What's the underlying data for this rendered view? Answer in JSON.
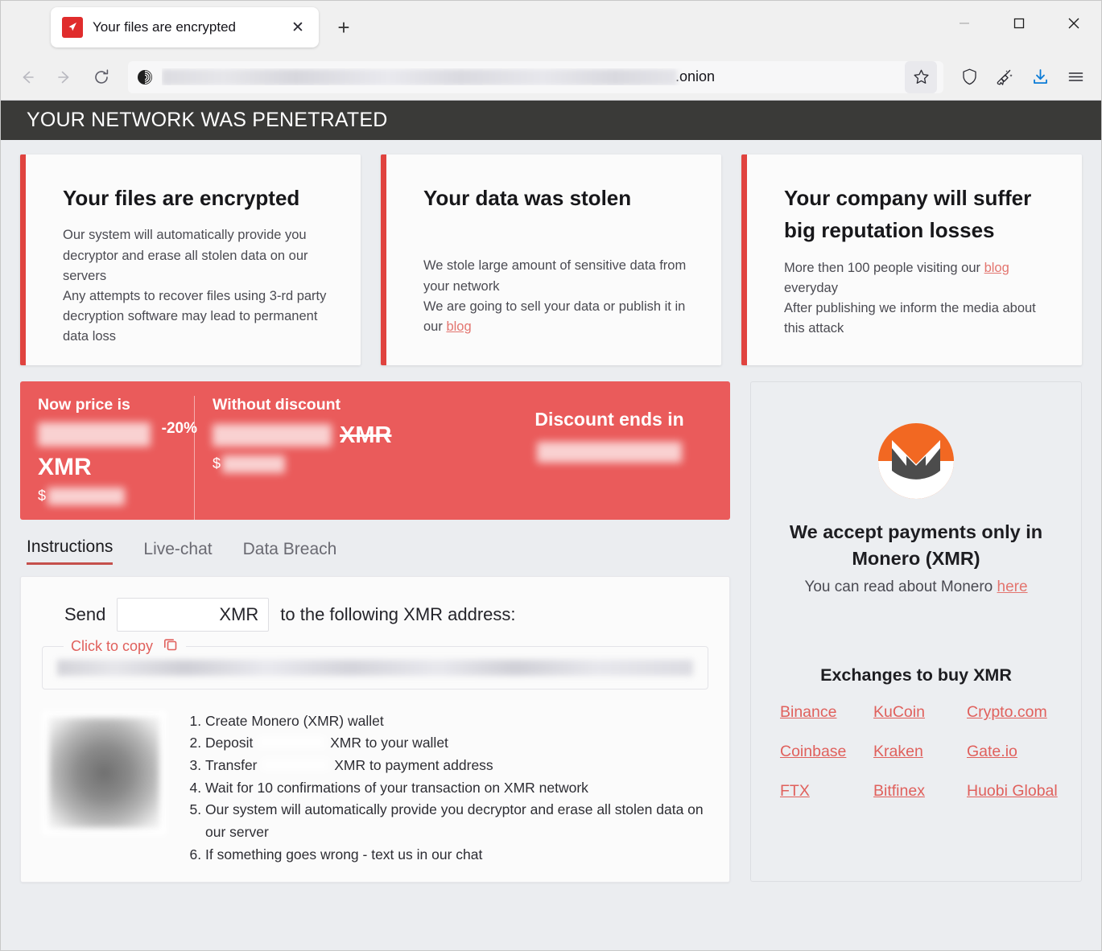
{
  "browser": {
    "tab": {
      "title": "Your files are encrypted",
      "favicon": "ransom-site-favicon",
      "close_label": "✕"
    },
    "new_tab_label": "+",
    "window_controls": {
      "minimize": "—",
      "maximize": "☐",
      "close": "✕"
    },
    "nav": {
      "back": "←",
      "forward": "→",
      "reload": "⟳"
    },
    "url": {
      "redacted": true,
      "suffix": ".onion",
      "security_icon": "tor-onion-icon"
    },
    "toolbar_icons": [
      "bookmark-star-icon",
      "shield-icon",
      "new-identity-broom-icon",
      "downloads-icon",
      "app-menu-icon"
    ]
  },
  "page": {
    "banner": "YOUR NETWORK WAS PENETRATED",
    "cards": [
      {
        "title": "Your files are encrypted",
        "lines": [
          "Our system will automatically provide you decryptor and erase all stolen data on our servers",
          "Any attempts to recover files using 3-rd party decryption software may lead to permanent data loss"
        ]
      },
      {
        "title": "Your data was stolen",
        "line1": "We stole large amount of sensitive data from your network",
        "line2_prefix": "We are going to sell your data or publish it in our ",
        "link": "blog"
      },
      {
        "title": "Your company will suffer big reputation losses",
        "line1_prefix": "More then 100 people visiting our ",
        "link": "blog",
        "line1_suffix": " everyday",
        "line2": "After publishing we inform the media about this attack"
      }
    ],
    "price": {
      "now_label": "Now price is",
      "now_amount": "REDACTED",
      "now_currency": "XMR",
      "now_usd_symbol": "$",
      "now_usd": "REDACTED",
      "discount_badge": "-20%",
      "without_label": "Without discount",
      "without_amount": "REDACTED",
      "without_currency": "XMR",
      "without_usd_symbol": "$",
      "without_usd": "REDACTED",
      "timer_label": "Discount ends in",
      "timer_value": "REDACTED"
    },
    "tabs": [
      {
        "label": "Instructions",
        "active": true
      },
      {
        "label": "Live-chat",
        "active": false
      },
      {
        "label": "Data Breach",
        "active": false
      }
    ],
    "instructions": {
      "send_prefix": "Send",
      "send_amount": "REDACTED",
      "send_currency": "XMR",
      "send_suffix": "to the following XMR address:",
      "copy_label": "Click to copy",
      "copy_icon": "copy-icon",
      "address_value": "REDACTED",
      "qr_alt": "xmr-address-qr-code",
      "steps": [
        {
          "text": "Create Monero (XMR) wallet"
        },
        {
          "prefix": "Deposit ",
          "amount": "REDACTED",
          "suffix": " XMR to your wallet"
        },
        {
          "prefix": "Transfer ",
          "amount": "REDACTED",
          "suffix": " XMR to payment address"
        },
        {
          "text": "Wait for 10 confirmations of your transaction on XMR network"
        },
        {
          "text": "Our system will automatically provide you decryptor and erase all stolen data on our server"
        },
        {
          "text": "If something goes wrong - text us in our chat"
        }
      ]
    },
    "sidebar": {
      "logo": "monero-logo",
      "accept_line1": "We accept payments only in",
      "accept_line2": "Monero (XMR)",
      "read_prefix": "You can read about Monero ",
      "read_link": "here",
      "exchanges_title": "Exchanges to buy XMR",
      "exchanges": [
        "Binance",
        "KuCoin",
        "Crypto.com",
        "Coinbase",
        "Kraken",
        "Gate.io",
        "FTX",
        "Bitfinex",
        "Huobi Global"
      ]
    }
  },
  "colors": {
    "accent_red": "#e0433f",
    "price_red": "#ea5b5b",
    "link_red": "#e0605c",
    "banner_dark": "#3a3a38",
    "monero_orange": "#f26822",
    "monero_dark": "#4c4c4c",
    "page_bg": "#ebedf0"
  }
}
